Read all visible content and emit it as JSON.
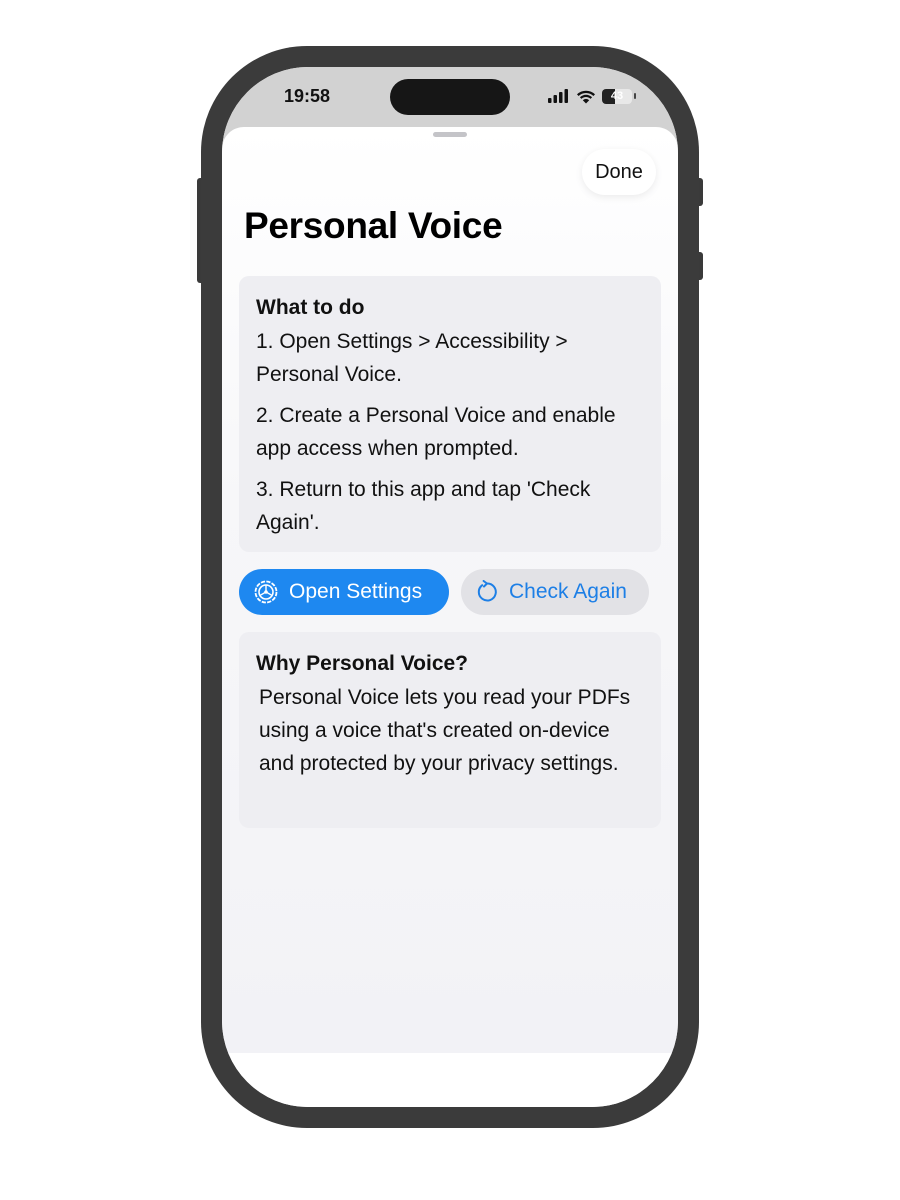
{
  "status_bar": {
    "time": "19:58",
    "battery": "43",
    "battery_level": 0.43,
    "icons": [
      "signal-icon",
      "wifi-icon",
      "battery-icon"
    ]
  },
  "sheet": {
    "done_label": "Done",
    "title": "Personal Voice"
  },
  "instructions": {
    "heading": "What to do",
    "steps": [
      "1. Open Settings > Accessibility > Personal Voice.",
      "2. Create a Personal Voice and enable app access when prompted.",
      "3. Return to this app and tap 'Check Again'."
    ]
  },
  "actions": {
    "open_settings_label": "Open Settings",
    "open_settings_icon": "gear-icon",
    "check_again_label": "Check Again",
    "check_again_icon": "refresh-icon"
  },
  "why": {
    "heading": "Why Personal Voice?",
    "body": "Personal Voice lets you read your PDFs using a voice that's created on-device and protected by your privacy settings."
  },
  "colors": {
    "accent": "#1e88f0",
    "secondary_button_bg": "#e2e2e6",
    "card_bg": "#eeeef2",
    "phone_frame": "#3b3b3b"
  }
}
